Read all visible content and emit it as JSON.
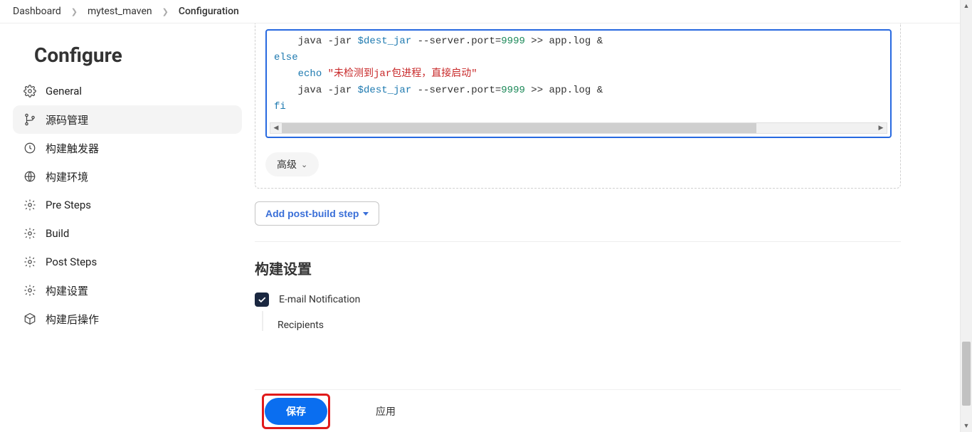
{
  "breadcrumb": {
    "items": [
      "Dashboard",
      "mytest_maven",
      "Configuration"
    ]
  },
  "page_title": "Configure",
  "sidebar": {
    "items": [
      {
        "label": "General",
        "active": false
      },
      {
        "label": "源码管理",
        "active": true
      },
      {
        "label": "构建触发器",
        "active": false
      },
      {
        "label": "构建环境",
        "active": false
      },
      {
        "label": "Pre Steps",
        "active": false
      },
      {
        "label": "Build",
        "active": false
      },
      {
        "label": "Post Steps",
        "active": false
      },
      {
        "label": "构建设置",
        "active": false
      },
      {
        "label": "构建后操作",
        "active": false
      }
    ]
  },
  "code": {
    "line1_indent": "    ",
    "line1_a": "java -jar ",
    "line1_b": "$dest_jar",
    "line1_c": " --server.port",
    "line1_eq": "=",
    "line1_num": "9999",
    "line1_d": " >> app.log ",
    "line1_amp": "&",
    "line2": "else",
    "line3_indent": "    ",
    "line3_echo": "echo ",
    "line3_str": "\"未检测到jar包进程，直接启动\"",
    "line4_indent": "    ",
    "line4_a": "java -jar ",
    "line4_b": "$dest_jar",
    "line4_c": " --server.port",
    "line4_eq": "=",
    "line4_num": "9999",
    "line4_d": " >> app.log ",
    "line4_amp": "&",
    "line5": "fi"
  },
  "advanced_btn": "高级",
  "add_post_build": "Add post-build step",
  "build_settings_title": "构建设置",
  "email_notification_label": "E-mail Notification",
  "recipients_label": "Recipients",
  "save_btn": "保存",
  "apply_btn": "应用"
}
